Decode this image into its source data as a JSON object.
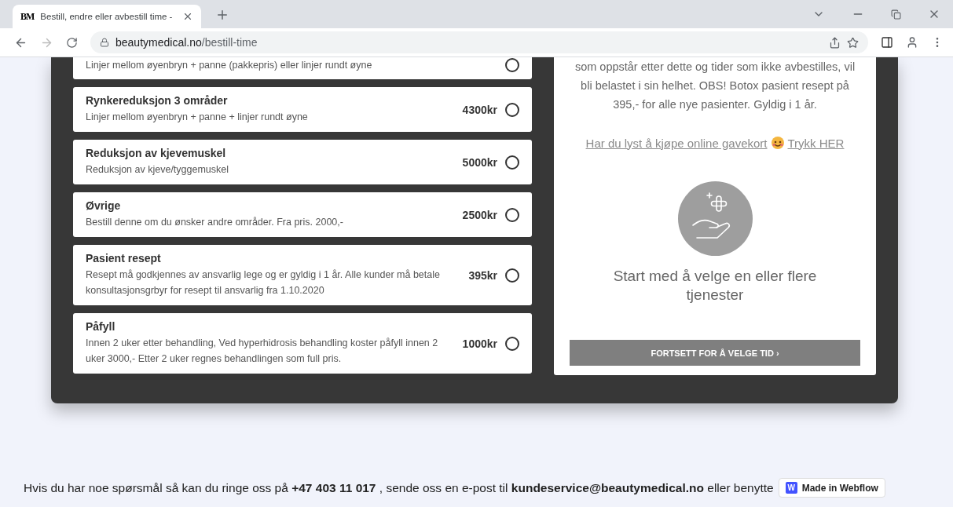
{
  "browser": {
    "tab": {
      "title": "Bestill, endre eller avbestill time -",
      "favicon": "BM"
    },
    "url": {
      "host": "beautymedical.no",
      "path": "/bestill-time"
    }
  },
  "services": [
    {
      "description": "Linjer mellom øyenbryn + panne (pakkepris) eller linjer rundt øyne",
      "selected": false
    },
    {
      "title": "Rynkereduksjon 3 områder",
      "description": "Linjer mellom øyenbryn + panne + linjer rundt øyne",
      "price": "4300kr",
      "selected": false
    },
    {
      "title": "Reduksjon av kjevemuskel",
      "description": "Reduksjon av kjeve/tyggemuskel",
      "price": "5000kr",
      "selected": false
    },
    {
      "title": "Øvrige",
      "description": "Bestill denne om du ønsker andre områder. Fra pris. 2000,-",
      "price": "2500kr",
      "selected": false
    },
    {
      "title": "Pasient resept",
      "description": "Resept må godkjennes av ansvarlig lege og er gyldig i 1 år. Alle kunder må betale konsultasjonsgrbyr for resept til ansvarlig fra 1.10.2020",
      "price": "395kr",
      "selected": false
    },
    {
      "title": "Påfyll",
      "description": "Innen 2 uker etter behandling, Ved hyperhidrosis behandling koster påfyll innen 2 uker 3000,- Etter 2 uker regnes behandlingen som full pris.",
      "price": "1000kr",
      "selected": false
    }
  ],
  "summary": {
    "notice": "som oppstår etter dette og tider som ikke avbestilles, vil bli belastet i sin helhet. OBS! Botox pasient resept på 395,- for alle nye pasienter. Gyldig i 1 år.",
    "gift_link": {
      "text": "Har du lyst å kjøpe online gavekort",
      "action": "Trykk HER"
    },
    "empty_message": "Start med å velge en eller flere tjenester",
    "continue_button": "FORTSETT FOR Å VELGE TID ›"
  },
  "footer": {
    "text": "Hvis du har noe spørsmål så kan du ringe oss på **+47 403 11 017** , sende oss en e-post til **kundeservice@beautymedical.no** eller benytte"
  },
  "badge": {
    "logo": "W",
    "label": "Made in Webflow"
  }
}
